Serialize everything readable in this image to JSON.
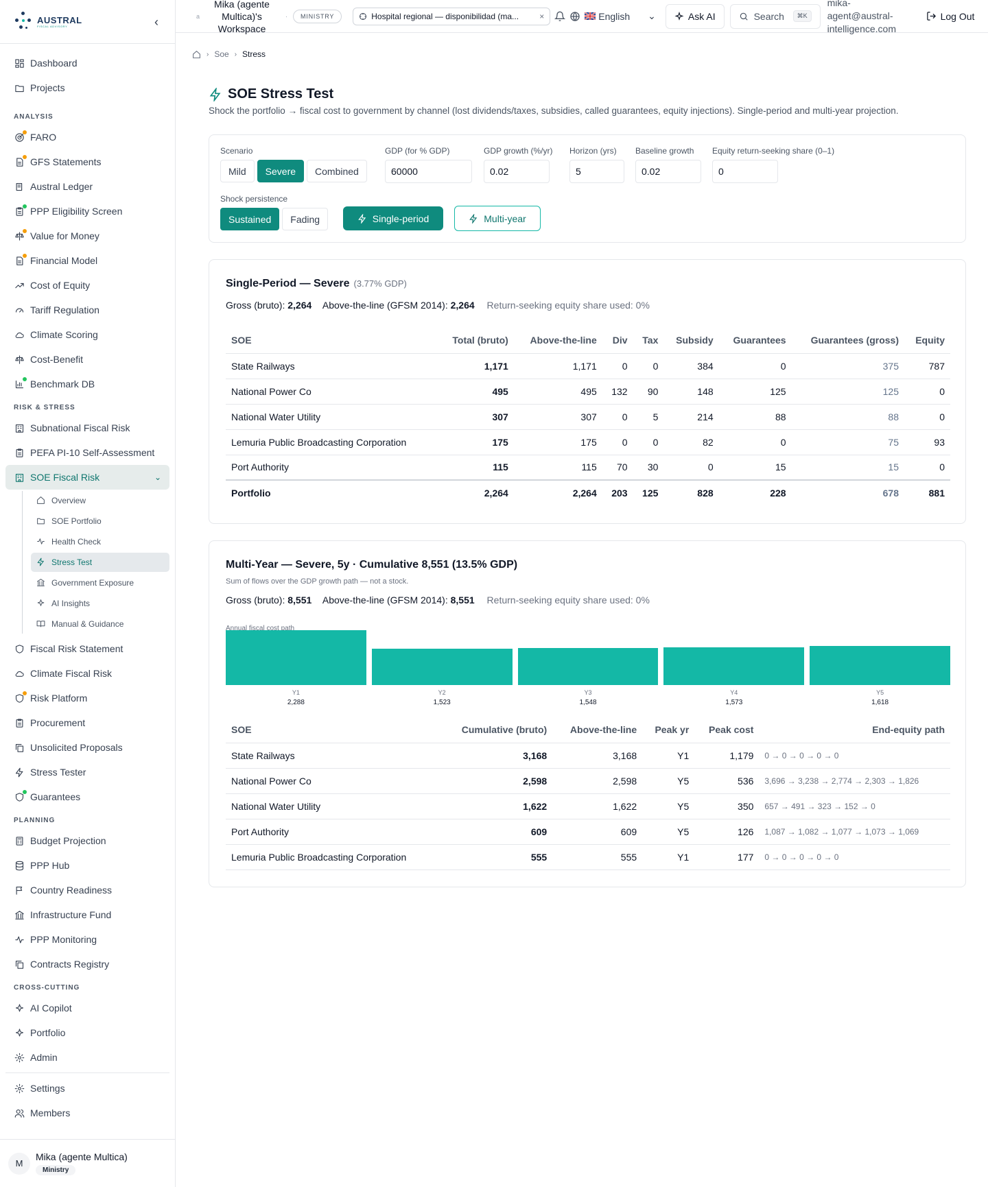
{
  "brand": {
    "name": "AUSTRAL",
    "tagline": "FISCAL ADVISORY"
  },
  "nav_top": [
    {
      "label": "Dashboard",
      "icon": "dashboard-icon"
    },
    {
      "label": "Projects",
      "icon": "folder-icon"
    }
  ],
  "sections": {
    "analysis": {
      "title": "ANALYSIS",
      "items": [
        {
          "label": "FARO",
          "icon": "target-icon",
          "dot": "orange"
        },
        {
          "label": "GFS Statements",
          "icon": "file-icon",
          "dot": "orange"
        },
        {
          "label": "Austral Ledger",
          "icon": "book-icon"
        },
        {
          "label": "PPP Eligibility Screen",
          "icon": "clipboard-icon",
          "dot": "green"
        },
        {
          "label": "Value for Money",
          "icon": "scale-icon",
          "dot": "orange"
        },
        {
          "label": "Financial Model",
          "icon": "file-icon",
          "dot": "orange"
        },
        {
          "label": "Cost of Equity",
          "icon": "trend-icon"
        },
        {
          "label": "Tariff Regulation",
          "icon": "gauge-icon"
        },
        {
          "label": "Climate Scoring",
          "icon": "cloud-icon"
        },
        {
          "label": "Cost-Benefit",
          "icon": "scale-icon"
        },
        {
          "label": "Benchmark DB",
          "icon": "chart-icon",
          "dot": "green"
        }
      ]
    },
    "risk": {
      "title": "RISK & STRESS",
      "items": [
        {
          "label": "Subnational Fiscal Risk",
          "icon": "building-icon"
        },
        {
          "label": "PEFA PI-10 Self-Assessment",
          "icon": "clipboard-icon"
        }
      ],
      "active": {
        "label": "SOE Fiscal Risk",
        "icon": "building-icon"
      },
      "sub": [
        {
          "label": "Overview",
          "icon": "home-icon"
        },
        {
          "label": "SOE Portfolio",
          "icon": "folder-icon"
        },
        {
          "label": "Health Check",
          "icon": "pulse-icon"
        },
        {
          "label": "Stress Test",
          "icon": "zap-icon",
          "active": true
        },
        {
          "label": "Government Exposure",
          "icon": "landmark-icon"
        },
        {
          "label": "AI Insights",
          "icon": "sparkle-icon"
        },
        {
          "label": "Manual & Guidance",
          "icon": "book-open-icon"
        }
      ],
      "after": [
        {
          "label": "Fiscal Risk Statement",
          "icon": "shield-icon"
        },
        {
          "label": "Climate Fiscal Risk",
          "icon": "cloud-icon"
        },
        {
          "label": "Risk Platform",
          "icon": "shield-icon",
          "dot": "orange"
        },
        {
          "label": "Procurement",
          "icon": "clipboard-icon"
        },
        {
          "label": "Unsolicited Proposals",
          "icon": "copy-icon"
        },
        {
          "label": "Stress Tester",
          "icon": "zap-icon"
        },
        {
          "label": "Guarantees",
          "icon": "shield-icon",
          "dot": "green"
        }
      ]
    },
    "planning": {
      "title": "PLANNING",
      "items": [
        {
          "label": "Budget Projection",
          "icon": "calculator-icon"
        },
        {
          "label": "PPP Hub",
          "icon": "database-icon"
        },
        {
          "label": "Country Readiness",
          "icon": "flag-icon"
        },
        {
          "label": "Infrastructure Fund",
          "icon": "landmark-icon"
        },
        {
          "label": "PPP Monitoring",
          "icon": "pulse-icon"
        },
        {
          "label": "Contracts Registry",
          "icon": "copy-icon"
        }
      ]
    },
    "cross": {
      "title": "CROSS-CUTTING",
      "items": [
        {
          "label": "AI Copilot",
          "icon": "sparkle-icon"
        },
        {
          "label": "Portfolio",
          "icon": "sparkle-icon"
        },
        {
          "label": "Admin",
          "icon": "gear-icon"
        }
      ]
    }
  },
  "nav_bottom": [
    {
      "label": "Settings",
      "icon": "gear-icon"
    },
    {
      "label": "Members",
      "icon": "users-icon"
    }
  ],
  "user": {
    "initial": "M",
    "name": "Mika (agente Multica)",
    "role": "Ministry"
  },
  "topbar": {
    "workspace": "Mika (agente Multica)'s Workspace",
    "ws_initial": "a",
    "role_pill": "MINISTRY",
    "context": "Hospital regional — disponibilidad (ma...",
    "language": "English",
    "ask_ai": "Ask AI",
    "search": "Search",
    "search_kbd": "⌘K",
    "email": "mika-agent@austral-intelligence.com",
    "logout": "Log Out"
  },
  "breadcrumb": {
    "one": "Soe",
    "two": "Stress"
  },
  "page": {
    "title": "SOE Stress Test",
    "description": "Shock the portfolio → fiscal cost to government by channel (lost dividends/taxes, subsidies, called guarantees, equity injections). Single-period and multi-year projection."
  },
  "controls": {
    "scenario_label": "Scenario",
    "scenarios": [
      "Mild",
      "Severe",
      "Combined"
    ],
    "scenario_selected": "Severe",
    "gdp_label": "GDP (for % GDP)",
    "gdp": "60000",
    "growth_label": "GDP growth (%/yr)",
    "growth": "0.02",
    "horizon_label": "Horizon (yrs)",
    "horizon": "5",
    "baseline_label": "Baseline growth",
    "baseline": "0.02",
    "equity_label": "Equity return-seeking share (0–1)",
    "equity": "0",
    "persistence_label": "Shock persistence",
    "persistence": [
      "Sustained",
      "Fading"
    ],
    "persistence_selected": "Sustained",
    "single_btn": "Single-period",
    "multi_btn": "Multi-year"
  },
  "single": {
    "title": "Single-Period — Severe",
    "pct": "(3.77% GDP)",
    "gross_label": "Gross (bruto):",
    "gross": "2,264",
    "atl_label": "Above-the-line (GFSM 2014):",
    "atl": "2,264",
    "rs_label": "Return-seeking equity share used: 0%",
    "headers": [
      "SOE",
      "Total (bruto)",
      "Above-the-line",
      "Div",
      "Tax",
      "Subsidy",
      "Guarantees",
      "Guarantees (gross)",
      "Equity"
    ],
    "rows": [
      [
        "State Railways",
        "1,171",
        "1,171",
        "0",
        "0",
        "384",
        "0",
        "375",
        "787"
      ],
      [
        "National Power Co",
        "495",
        "495",
        "132",
        "90",
        "148",
        "125",
        "125",
        "0"
      ],
      [
        "National Water Utility",
        "307",
        "307",
        "0",
        "5",
        "214",
        "88",
        "88",
        "0"
      ],
      [
        "Lemuria Public Broadcasting Corporation",
        "175",
        "175",
        "0",
        "0",
        "82",
        "0",
        "75",
        "93"
      ],
      [
        "Port Authority",
        "115",
        "115",
        "70",
        "30",
        "0",
        "15",
        "15",
        "0"
      ]
    ],
    "total": [
      "Portfolio",
      "2,264",
      "2,264",
      "203",
      "125",
      "828",
      "228",
      "678",
      "881"
    ]
  },
  "multi": {
    "title": "Multi-Year — Severe, 5y · Cumulative 8,551 (13.5% GDP)",
    "subtitle": "Sum of flows over the GDP growth path — not a stock.",
    "gross_label": "Gross (bruto):",
    "gross": "8,551",
    "atl_label": "Above-the-line (GFSM 2014):",
    "atl": "8,551",
    "rs_label": "Return-seeking equity share used: 0%",
    "headers": [
      "SOE",
      "Cumulative (bruto)",
      "Above-the-line",
      "Peak yr",
      "Peak cost",
      "End-equity path"
    ],
    "rows": [
      [
        "State Railways",
        "3,168",
        "3,168",
        "Y1",
        "1,179",
        "0 → 0 → 0 → 0 → 0"
      ],
      [
        "National Power Co",
        "2,598",
        "2,598",
        "Y5",
        "536",
        "3,696 → 3,238 → 2,774 → 2,303 → 1,826"
      ],
      [
        "National Water Utility",
        "1,622",
        "1,622",
        "Y5",
        "350",
        "657 → 491 → 323 → 152 → 0"
      ],
      [
        "Port Authority",
        "609",
        "609",
        "Y5",
        "126",
        "1,087 → 1,082 → 1,077 → 1,073 → 1,069"
      ],
      [
        "Lemuria Public Broadcasting Corporation",
        "555",
        "555",
        "Y1",
        "177",
        "0 → 0 → 0 → 0 → 0"
      ]
    ]
  },
  "chart_data": {
    "type": "bar",
    "title": "Annual fiscal cost path",
    "categories": [
      "Y1",
      "Y2",
      "Y3",
      "Y4",
      "Y5"
    ],
    "values": [
      2288,
      1523,
      1548,
      1573,
      1618
    ],
    "value_labels": [
      "2,288",
      "1,523",
      "1,548",
      "1,573",
      "1,618"
    ],
    "color": "#14b8a6"
  }
}
